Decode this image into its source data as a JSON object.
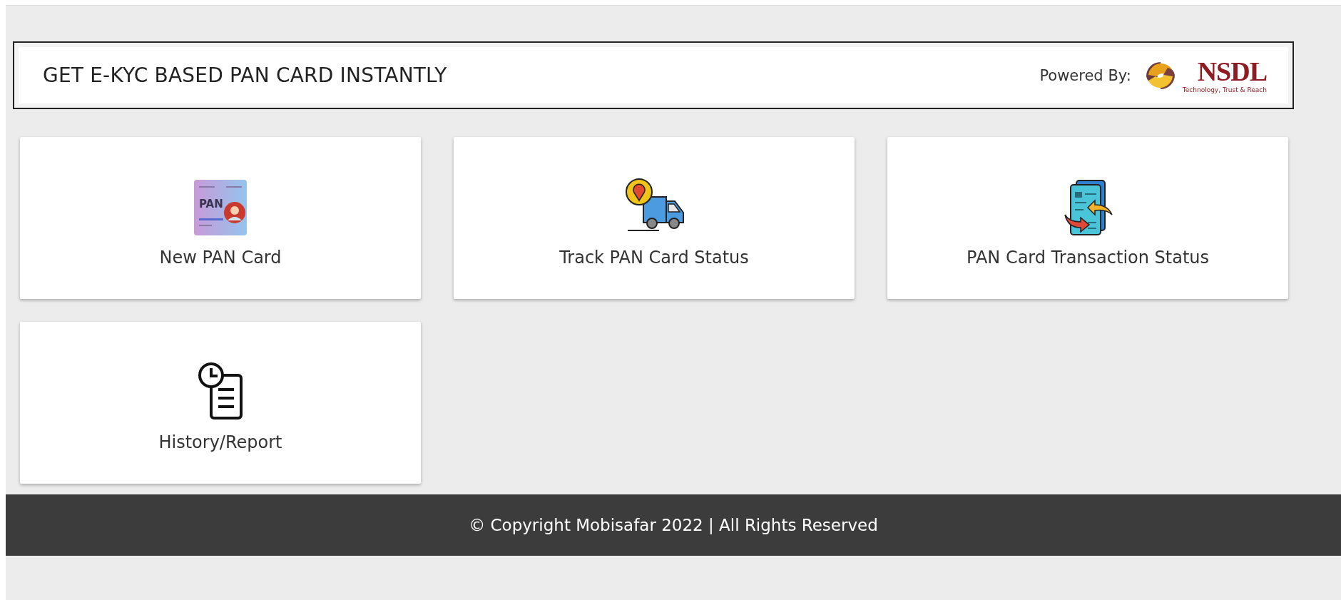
{
  "header": {
    "title": "GET E-KYC BASED PAN CARD INSTANTLY",
    "powered_by": "Powered By:",
    "logo": {
      "name": "NSDL",
      "tagline": "Technology, Trust & Reach"
    }
  },
  "services": [
    {
      "label": "New PAN Card",
      "kind": "pan-card",
      "icon_text": "PAN"
    },
    {
      "label": "Track PAN Card Status",
      "kind": "truck"
    },
    {
      "label": "PAN Card Transaction Status",
      "kind": "documents"
    },
    {
      "label": "History/Report",
      "kind": "history"
    }
  ],
  "footer": {
    "text": "© Copyright Mobisafar 2022 | All Rights Reserved"
  }
}
